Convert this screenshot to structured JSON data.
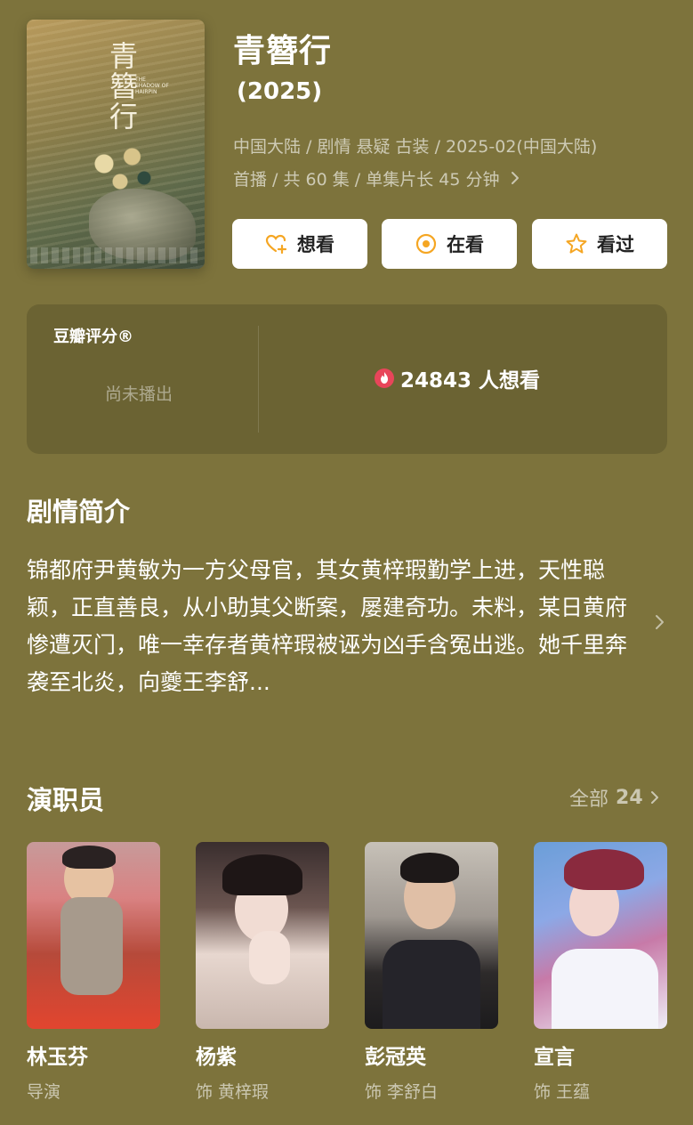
{
  "header": {
    "poster_title": "青簪行",
    "poster_subtitle": "THE SHADOW OF HAIRPIN",
    "title": "青簪行",
    "year": "(2025)",
    "meta_line1": "中国大陆 / 剧情 悬疑 古装 / 2025-02(中国大陆)",
    "meta_line2": "首播 / 共 60 集 / 单集片长 45 分钟",
    "buttons": {
      "want": "想看",
      "watching": "在看",
      "watched": "看过"
    },
    "colors": {
      "accent": "#f5a623",
      "background": "#7d733c"
    }
  },
  "rating": {
    "label": "豆瓣评分®",
    "status": "尚未播出",
    "wish_count": "24843 人想看",
    "fire_color": "#e8455a"
  },
  "synopsis": {
    "title": "剧情简介",
    "text": "锦都府尹黄敏为一方父母官，其女黄梓瑕勤学上进，天性聪颖，正直善良，从小助其父断案，屡建奇功。未料，某日黄府惨遭灭门，唯一幸存者黄梓瑕被诬为凶手含冤出逃。她千里奔袭至北炎，向夔王李舒..."
  },
  "cast": {
    "title": "演职员",
    "all_label": "全部",
    "all_count": "24",
    "members": [
      {
        "name": "林玉芬",
        "role": "导演"
      },
      {
        "name": "杨紫",
        "role": "饰 黄梓瑕"
      },
      {
        "name": "彭冠英",
        "role": "饰 李舒白"
      },
      {
        "name": "宣言",
        "role": "饰 王蕴"
      }
    ]
  }
}
